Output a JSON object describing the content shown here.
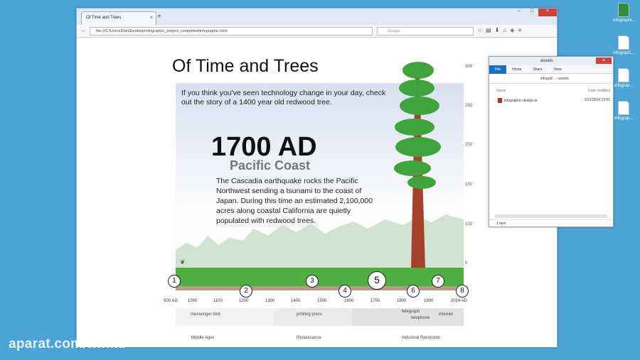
{
  "desktop_icons": [
    {
      "label": "infographi..."
    },
    {
      "label": "infograph..."
    },
    {
      "label": "infograp..."
    },
    {
      "label": "infograp..."
    }
  ],
  "browser": {
    "tab_title": "Of Time and Trees",
    "url": "file:///C:/Users/Dan/Desktop/infographic_project_completed/infographic.html",
    "search_placeholder": "Google"
  },
  "page": {
    "title": "Of Time and Trees",
    "intro": "If you think you've seen technology change in your day, check out the story of a 1400 year old redwood tree.",
    "year": "1700 AD",
    "place": "Pacific Coast",
    "body": "The Cascadia earthquake rocks the Pacific Northwest sending a tsunami to the coast of Japan. During this time an estimated 2,100,000 acres along coastal California are quietly populated with redwood trees.",
    "y_axis": [
      "300 '",
      "250 '",
      "200 '",
      "150 '",
      "100 '",
      "0"
    ],
    "markers": [
      "1",
      "2",
      "3",
      "4",
      "5",
      "6",
      "7",
      "8"
    ],
    "ticks": [
      "500 AD",
      "1000",
      "1100",
      "1200",
      "1300",
      "1400",
      "1500",
      "1600",
      "1700",
      "1800",
      "1900",
      "2014 AD"
    ],
    "events": {
      "messenger": "messenger bird",
      "printing": "printing press",
      "telegraph": "telegraph",
      "telephone": "telephone",
      "internet": "internet"
    },
    "eras": [
      "Middle Ages",
      "Renaissance",
      "Industrial Revolution"
    ]
  },
  "explorer": {
    "title": "assets",
    "tabs": [
      "File",
      "Home",
      "Share",
      "View"
    ],
    "breadcrumb": "infograf... › assets",
    "col_name": "Name",
    "col_date": "Date modified",
    "file_name": "infographic-design.ai",
    "file_date": "2/12/2014 12:51",
    "status": "1 item"
  },
  "watermark": "aparat.com/winku"
}
